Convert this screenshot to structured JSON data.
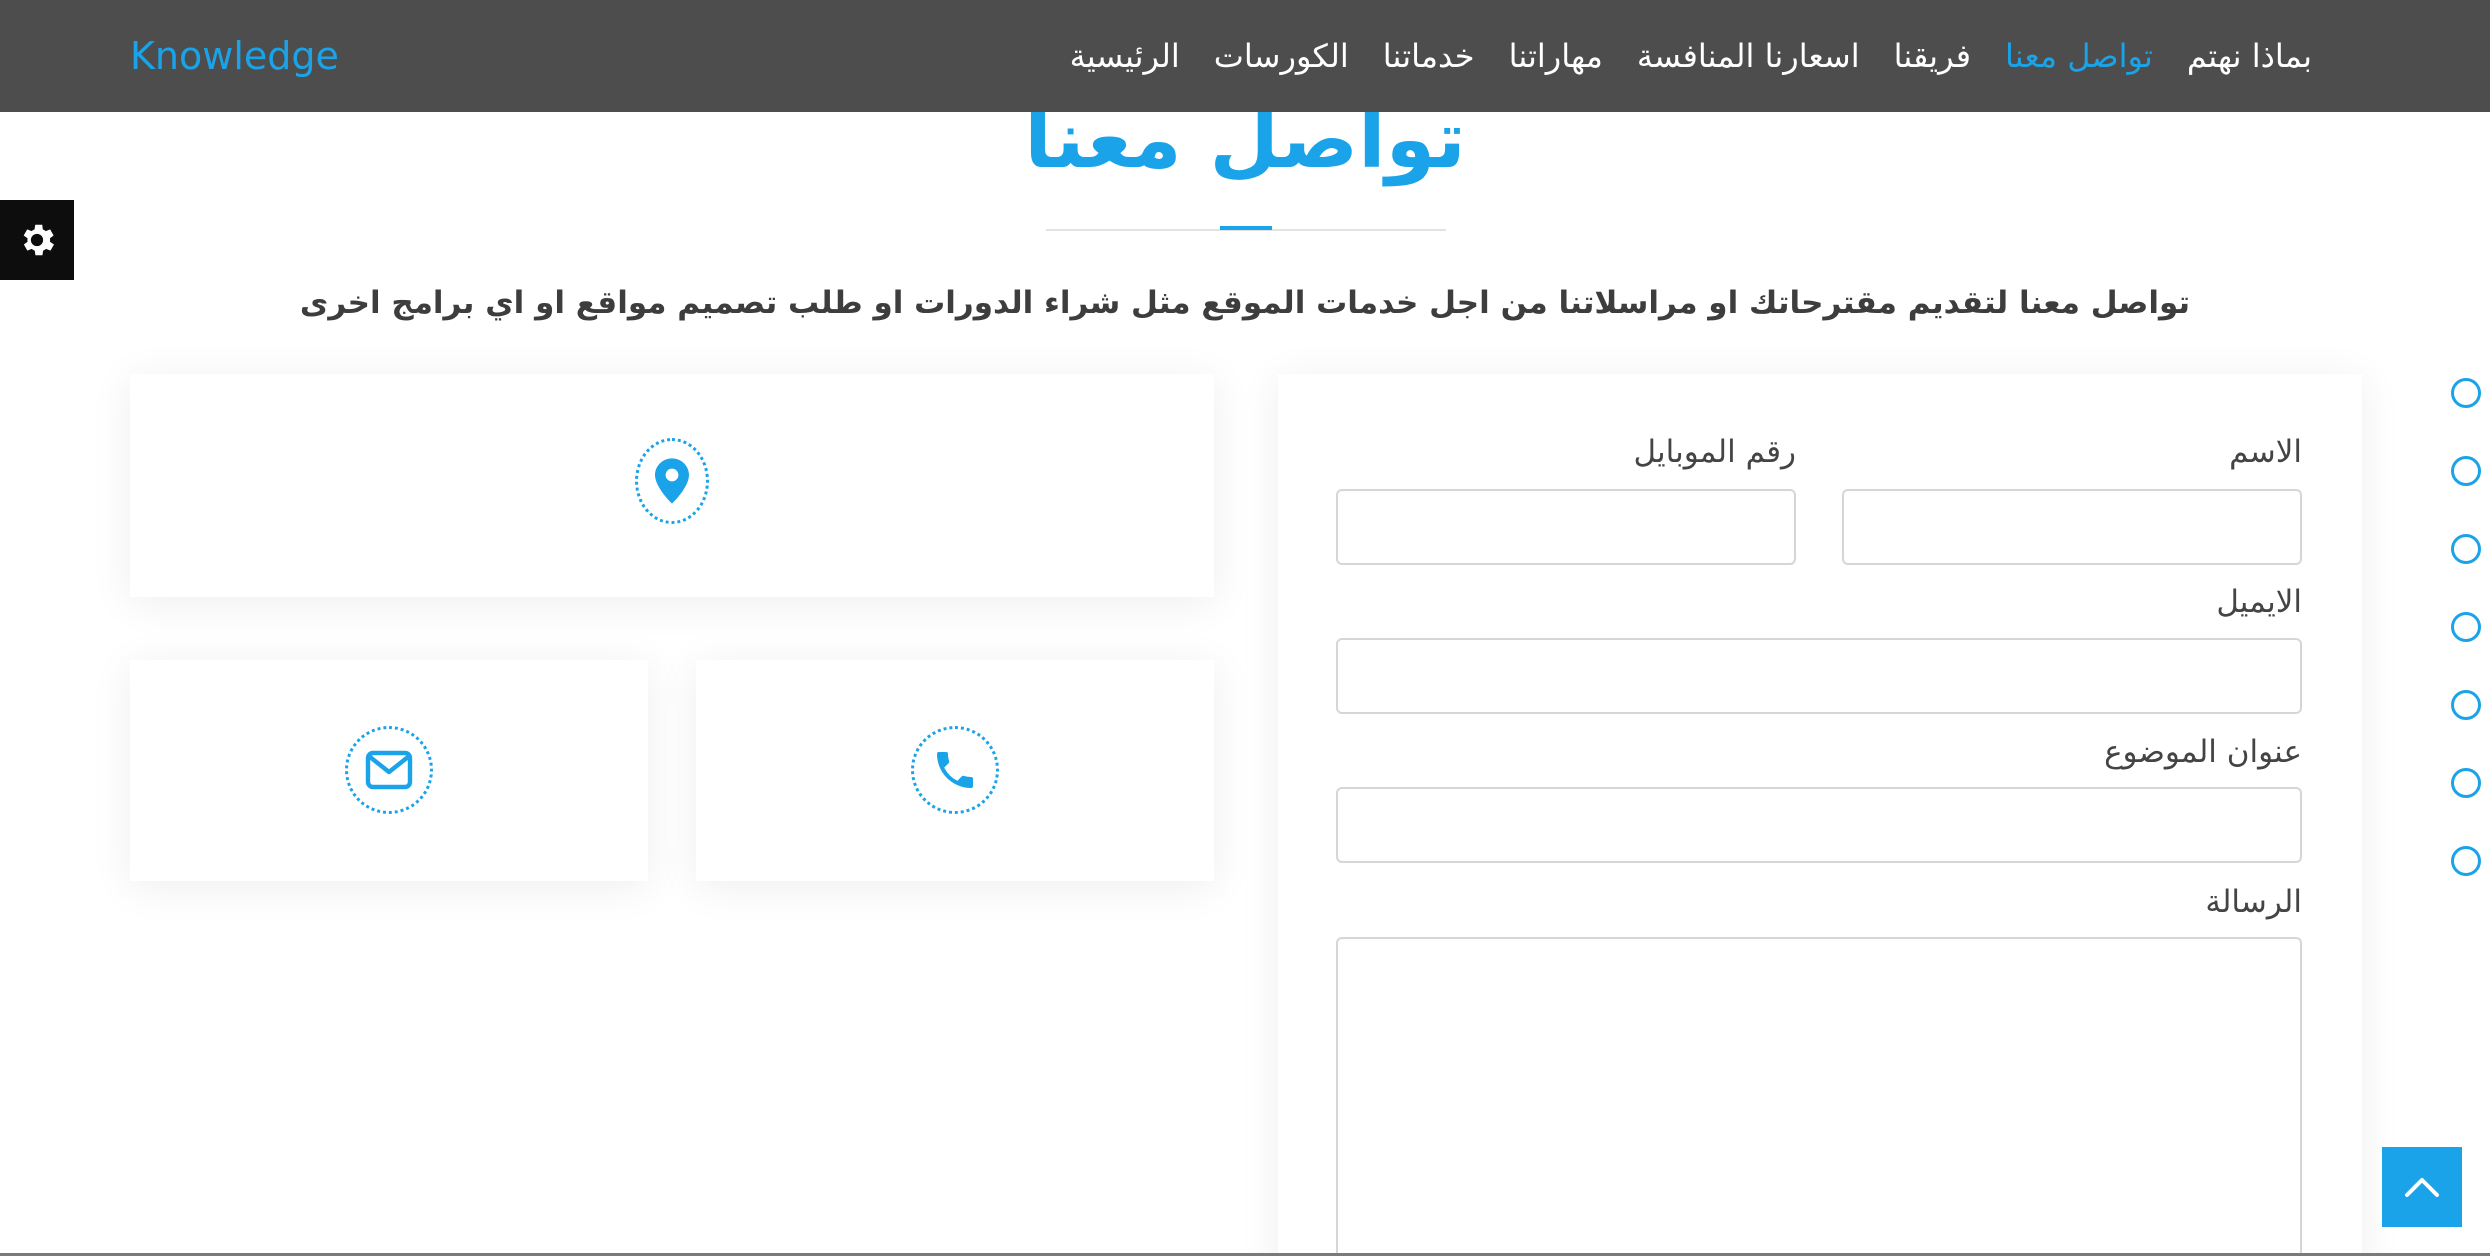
{
  "brand": "Knowledge",
  "nav": {
    "items": [
      {
        "label": "الرئيسية"
      },
      {
        "label": "الكورسات"
      },
      {
        "label": "خدماتنا"
      },
      {
        "label": "مهاراتنا"
      },
      {
        "label": "اسعارنا المنافسة"
      },
      {
        "label": "فريقنا"
      },
      {
        "label": "تواصل معنا",
        "active": true
      },
      {
        "label": "بماذا نهتم"
      }
    ]
  },
  "section": {
    "title": "تواصل معنا",
    "subtitle": "تواصل معنا لتقديم مقترحاتك او مراسلاتنا من اجل خدمات الموقع مثل شراء الدورات او طلب تصميم مواقع او اي برامج اخرى"
  },
  "contact_cards": {
    "address_icon": "map-marker-icon",
    "phone_icon": "phone-icon",
    "email_icon": "envelope-icon"
  },
  "form": {
    "name_label": "الاسم",
    "name_value": "",
    "mobile_label": "رقم الموبايل",
    "mobile_value": "",
    "email_label": "الايميل",
    "email_value": "",
    "subject_label": "عنوان الموضوع",
    "subject_value": "",
    "message_label": "الرسالة",
    "message_value": ""
  },
  "side_dots_count": 7,
  "colors": {
    "accent": "#1aa3e8",
    "navbar": "#4d4d4d",
    "settings_tab": "#0d0d0d"
  }
}
